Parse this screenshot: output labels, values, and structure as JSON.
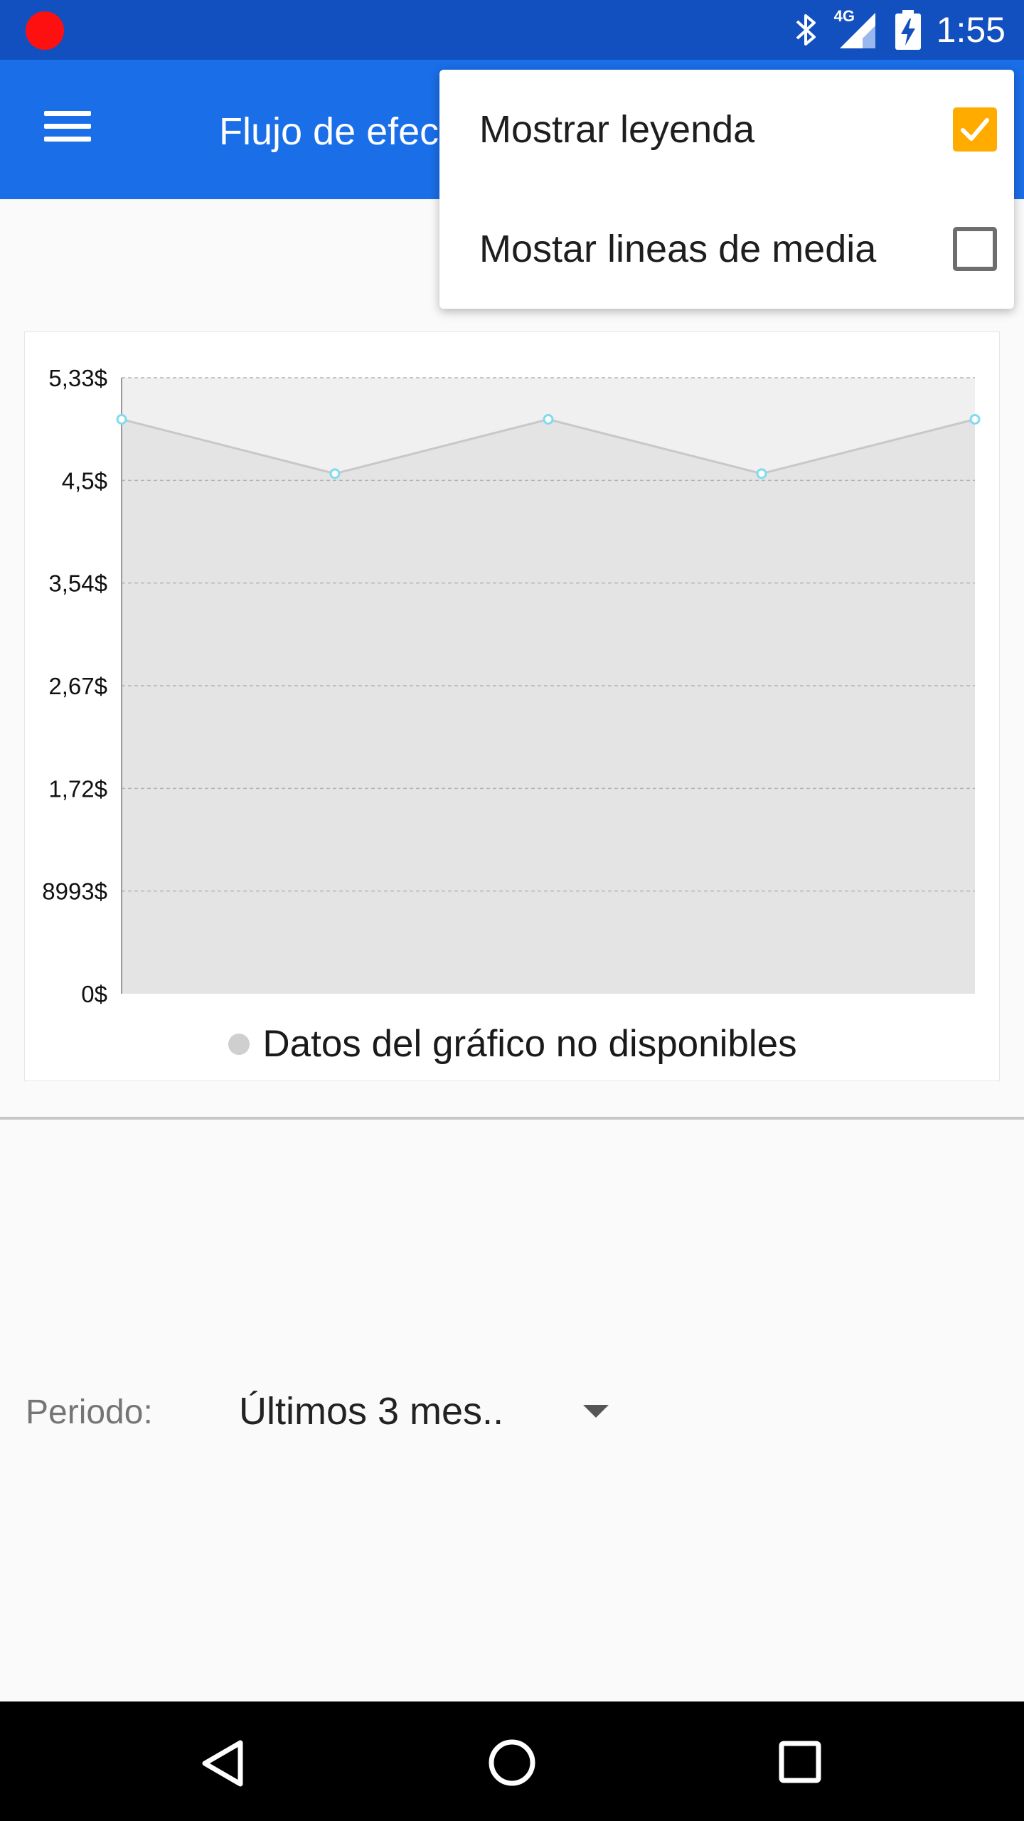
{
  "status_bar": {
    "time": "1:55",
    "network": "4G",
    "icons": [
      "record-dot",
      "bluetooth-icon",
      "signal-icon",
      "battery-charging-icon"
    ]
  },
  "app_bar": {
    "title": "Flujo de efec",
    "menu_icon": "hamburger-menu-icon"
  },
  "overflow_menu": {
    "items": [
      {
        "label": "Mostrar leyenda",
        "checked": true
      },
      {
        "label": "Mostar lineas de media",
        "checked": false
      }
    ]
  },
  "chart_data": {
    "type": "area",
    "y_tick_labels": [
      "5,33$",
      "4,5$",
      "3,54$",
      "2,67$",
      "1,72$",
      "8993$",
      "0$"
    ],
    "ylim": [
      0,
      5.33
    ],
    "x": [
      1,
      2,
      3,
      4,
      5
    ],
    "series": [
      {
        "name": "Datos del gráfico no disponibles",
        "values": [
          4.97,
          4.5,
          4.97,
          4.5,
          4.97
        ]
      }
    ],
    "grid": true,
    "legend": "bottom-center",
    "colors": {
      "fill": "#e4e4e4",
      "line": "#c8c8c8",
      "point": "#7fdcf0",
      "plot_bg": "#f0f0f0"
    }
  },
  "period": {
    "label": "Periodo:",
    "value": "Últimos 3 mes.."
  },
  "nav_bar": {
    "icons": [
      "back-icon",
      "home-icon",
      "recents-icon"
    ]
  },
  "colors": {
    "status_bar": "#1250bf",
    "app_bar": "#1a6ee8",
    "checkbox_checked": "#ffab00"
  }
}
